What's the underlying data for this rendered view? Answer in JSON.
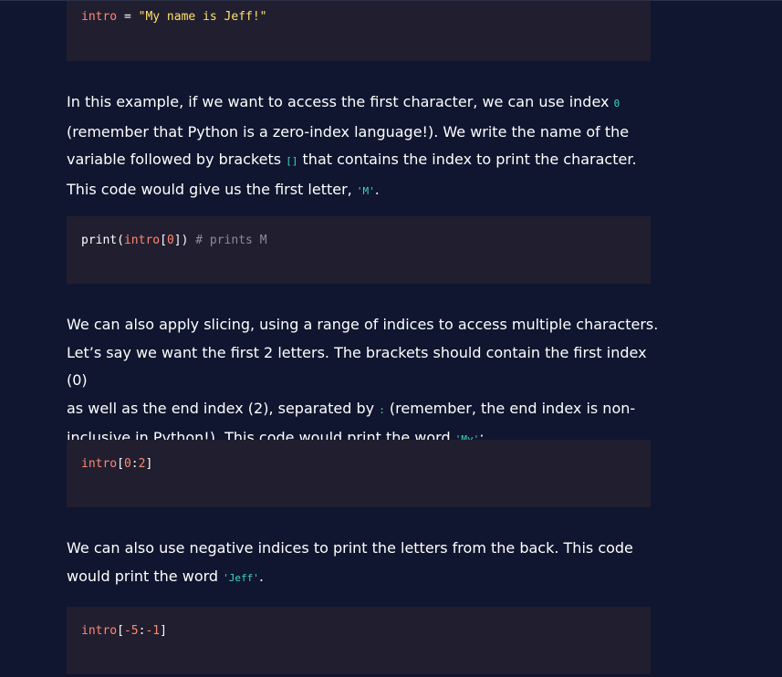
{
  "code_blocks": [
    {
      "tokens": [
        {
          "t": "intro",
          "k": "var"
        },
        {
          "t": " = ",
          "k": "pun"
        },
        {
          "t": "\"My name is Jeff!\"",
          "k": "str"
        }
      ]
    },
    {
      "tokens": [
        {
          "t": "print",
          "k": "fn"
        },
        {
          "t": "(",
          "k": "pun"
        },
        {
          "t": "intro",
          "k": "var"
        },
        {
          "t": "[",
          "k": "pun"
        },
        {
          "t": "0",
          "k": "num"
        },
        {
          "t": "])",
          "k": "pun"
        },
        {
          "t": " # prints M",
          "k": "cmt"
        }
      ]
    },
    {
      "tokens": [
        {
          "t": "intro",
          "k": "var"
        },
        {
          "t": "[",
          "k": "pun"
        },
        {
          "t": "0",
          "k": "num"
        },
        {
          "t": ":",
          "k": "pun"
        },
        {
          "t": "2",
          "k": "num"
        },
        {
          "t": "]",
          "k": "pun"
        }
      ]
    },
    {
      "tokens": [
        {
          "t": "intro",
          "k": "var"
        },
        {
          "t": "[",
          "k": "pun"
        },
        {
          "t": "-5",
          "k": "num"
        },
        {
          "t": ":",
          "k": "pun"
        },
        {
          "t": "-1",
          "k": "num"
        },
        {
          "t": "]",
          "k": "pun"
        }
      ]
    }
  ],
  "paragraphs": [
    {
      "lines": [
        [
          {
            "t": "In this example, if we want to access the first character, we can use index "
          },
          {
            "t": "0",
            "code": true
          }
        ],
        [
          {
            "t": "(remember that Python is a zero-index language!). We write the name of the"
          }
        ],
        [
          {
            "t": "variable followed by brackets "
          },
          {
            "t": "[]",
            "code": true
          },
          {
            "t": " that contains the index to print the character."
          }
        ],
        [
          {
            "t": "This code would give us the first letter, "
          },
          {
            "t": "'M'",
            "code": true
          },
          {
            "t": "."
          }
        ]
      ]
    },
    {
      "lines": [
        [
          {
            "t": "We can also apply slicing, using a range of indices to access multiple characters."
          }
        ],
        [
          {
            "t": "Let’s say we want the first 2 letters. The brackets should contain the first index (0)"
          }
        ],
        [
          {
            "t": "as well as the end index (2), separated by "
          },
          {
            "t": ":",
            "code": true
          },
          {
            "t": " (remember, the end index is non-"
          }
        ],
        [
          {
            "t": "inclusive in Python!). This code would print the word "
          },
          {
            "t": "'My'",
            "code": true
          },
          {
            "t": ":"
          }
        ]
      ]
    },
    {
      "lines": [
        [
          {
            "t": "We can also use negative indices to print the letters from the back. This code"
          }
        ],
        [
          {
            "t": "would print the word "
          },
          {
            "t": "'Jeff'",
            "code": true
          },
          {
            "t": "."
          }
        ]
      ]
    }
  ]
}
